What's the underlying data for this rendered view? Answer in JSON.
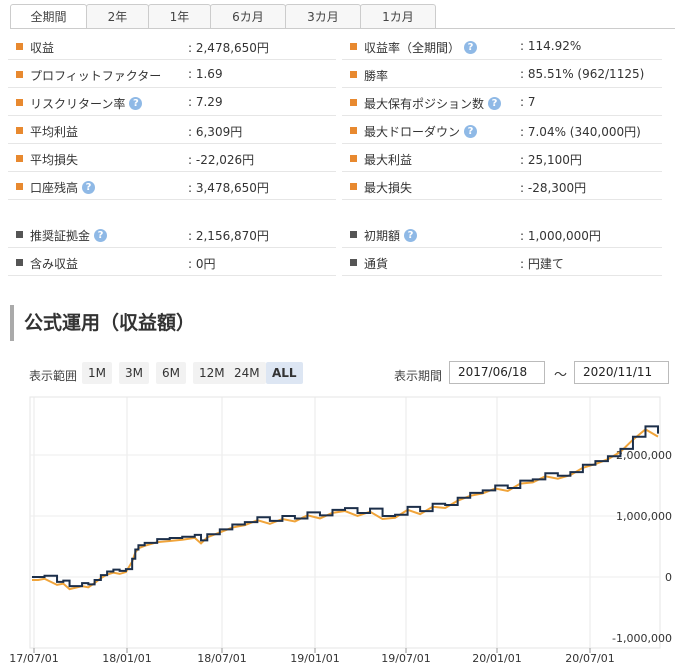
{
  "tabs": [
    "全期間",
    "2年",
    "1年",
    "6カ月",
    "3カ月",
    "1カ月"
  ],
  "tab_widths": [
    77,
    63,
    63,
    76,
    76,
    76
  ],
  "colors": {
    "orange": "#e8892f",
    "dark": "#555555",
    "line": "#1c2f4a",
    "fill": "#f0a43a",
    "help": "#8fb9e6"
  },
  "icons": {
    "help": "question-circle-icon",
    "bullet": "square-bullet-icon"
  },
  "stats_main": [
    {
      "l": {
        "label": "収益",
        "help": false,
        "value": ": 2,478,650円"
      },
      "r": {
        "label": "収益率（全期間）",
        "help": true,
        "value": ": 114.92%"
      }
    },
    {
      "l": {
        "label": "プロフィットファクター",
        "help": false,
        "value": ": 1.69"
      },
      "r": {
        "label": "勝率",
        "help": false,
        "value": ": 85.51% (962/1125)"
      }
    },
    {
      "l": {
        "label": "リスクリターン率",
        "help": true,
        "value": ": 7.29"
      },
      "r": {
        "label": "最大保有ポジション数",
        "help": true,
        "value": ": 7"
      }
    },
    {
      "l": {
        "label": "平均利益",
        "help": false,
        "value": ": 6,309円"
      },
      "r": {
        "label": "最大ドローダウン",
        "help": true,
        "value": ": 7.04% (340,000円)"
      }
    },
    {
      "l": {
        "label": "平均損失",
        "help": false,
        "value": ": -22,026円"
      },
      "r": {
        "label": "最大利益",
        "help": false,
        "value": ": 25,100円"
      }
    },
    {
      "l": {
        "label": "口座残高",
        "help": true,
        "value": ": 3,478,650円"
      },
      "r": {
        "label": "最大損失",
        "help": false,
        "value": ": -28,300円"
      }
    }
  ],
  "stats_sub": [
    {
      "l": {
        "label": "推奨証拠金",
        "help": true,
        "value": ": 2,156,870円"
      },
      "r": {
        "label": "初期額",
        "help": true,
        "value": ": 1,000,000円"
      }
    },
    {
      "l": {
        "label": "含み収益",
        "help": false,
        "value": ": 0円"
      },
      "r": {
        "label": "通貨",
        "help": false,
        "value": ": 円建て"
      }
    }
  ],
  "section_title": "公式運用（収益額）",
  "range": {
    "label": "表示範囲",
    "buttons": [
      "1M",
      "3M",
      "6M",
      "12M",
      "24M",
      "ALL"
    ],
    "selected": "ALL"
  },
  "period": {
    "label": "表示期間",
    "from": "2017/06/18",
    "to": "2020/11/11",
    "sep": "〜"
  },
  "chart_data": {
    "type": "line",
    "x_ticks": [
      "17/07/01",
      "18/01/01",
      "18/07/01",
      "19/01/01",
      "19/07/01",
      "20/01/01",
      "20/07/01"
    ],
    "y_ticks": [
      "2,000,000",
      "1,000,000",
      "0",
      "-1,000,000"
    ],
    "ylim": [
      -1000000,
      2600000
    ],
    "series": [
      {
        "x": [
          0,
          0.01,
          0.02,
          0.04,
          0.05,
          0.06,
          0.08,
          0.09,
          0.1,
          0.11,
          0.12,
          0.13,
          0.14,
          0.15,
          0.16,
          0.165,
          0.17,
          0.18,
          0.2,
          0.22,
          0.24,
          0.26,
          0.27,
          0.28,
          0.3,
          0.32,
          0.34,
          0.36,
          0.38,
          0.4,
          0.42,
          0.44,
          0.46,
          0.48,
          0.5,
          0.52,
          0.54,
          0.56,
          0.58,
          0.6,
          0.62,
          0.64,
          0.66,
          0.68,
          0.7,
          0.72,
          0.74,
          0.76,
          0.78,
          0.8,
          0.82,
          0.84,
          0.86,
          0.88,
          0.9,
          0.92,
          0.94,
          0.96,
          0.98,
          1.0
        ],
        "y": [
          0,
          0,
          20000,
          -80000,
          -60000,
          -150000,
          -100000,
          -120000,
          -50000,
          30000,
          90000,
          120000,
          100000,
          130000,
          300000,
          450000,
          520000,
          560000,
          620000,
          640000,
          660000,
          690000,
          600000,
          700000,
          780000,
          860000,
          900000,
          980000,
          920000,
          1000000,
          960000,
          1060000,
          1010000,
          1100000,
          1130000,
          1050000,
          1120000,
          1000000,
          1020000,
          1150000,
          1080000,
          1200000,
          1180000,
          1300000,
          1380000,
          1420000,
          1500000,
          1460000,
          1580000,
          1600000,
          1700000,
          1660000,
          1720000,
          1840000,
          1900000,
          1980000,
          2100000,
          2300000,
          2470000,
          2350000
        ]
      }
    ]
  }
}
